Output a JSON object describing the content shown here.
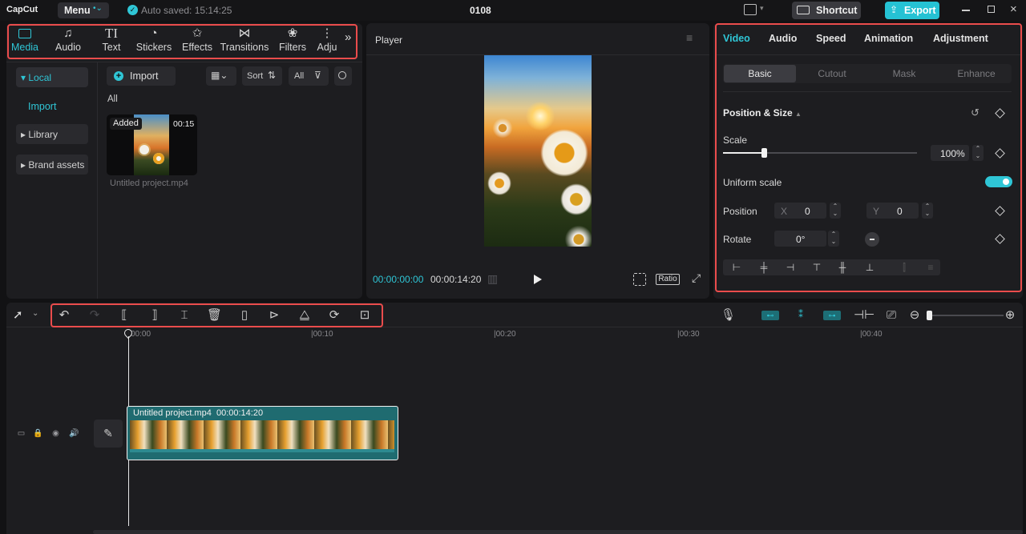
{
  "app": {
    "logo": "CapCut",
    "menu_label": "Menu",
    "autosave": "Auto saved: 15:14:25",
    "project_title": "0108",
    "shortcut_label": "Shortcut",
    "export_label": "Export"
  },
  "top_tabs": [
    {
      "label": "Media",
      "icon": "media-icon"
    },
    {
      "label": "Audio",
      "icon": "audio-icon"
    },
    {
      "label": "Text",
      "icon": "text-icon"
    },
    {
      "label": "Stickers",
      "icon": "stickers-icon"
    },
    {
      "label": "Effects",
      "icon": "effects-icon"
    },
    {
      "label": "Transitions",
      "icon": "transitions-icon"
    },
    {
      "label": "Filters",
      "icon": "filters-icon"
    },
    {
      "label": "Adju",
      "icon": "adjust-icon"
    }
  ],
  "media": {
    "sidebar": [
      "Local",
      "Import",
      "Library",
      "Brand assets"
    ],
    "import_label": "Import",
    "sort_label": "Sort",
    "filter_label": "All",
    "section_label": "All",
    "clip": {
      "badge": "Added",
      "duration": "00:15",
      "name": "Untitled project.mp4"
    }
  },
  "player": {
    "title": "Player",
    "current_time": "00:00:00:00",
    "total_time": "00:00:14:20",
    "ratio_label": "Ratio"
  },
  "inspector": {
    "tabs": [
      "Video",
      "Audio",
      "Speed",
      "Animation",
      "Adjustment"
    ],
    "subtabs": [
      "Basic",
      "Cutout",
      "Mask",
      "Enhance"
    ],
    "section_title": "Position & Size",
    "scale_label": "Scale",
    "scale_value": "100%",
    "scale_fraction": 0.21,
    "uniform_label": "Uniform scale",
    "position_label": "Position",
    "x_label": "X",
    "x_value": "0",
    "y_label": "Y",
    "y_value": "0",
    "rotate_label": "Rotate",
    "rotate_value": "0°"
  },
  "timeline": {
    "ruler": [
      "00:00",
      "|00:10",
      "|00:20",
      "|00:30",
      "|00:40"
    ],
    "clip_name": "Untitled project.mp4",
    "clip_duration": "00:00:14:20"
  },
  "colors": {
    "accent": "#2fc6d6",
    "highlight": "#ea4c4c",
    "clip": "#1f6b70"
  }
}
